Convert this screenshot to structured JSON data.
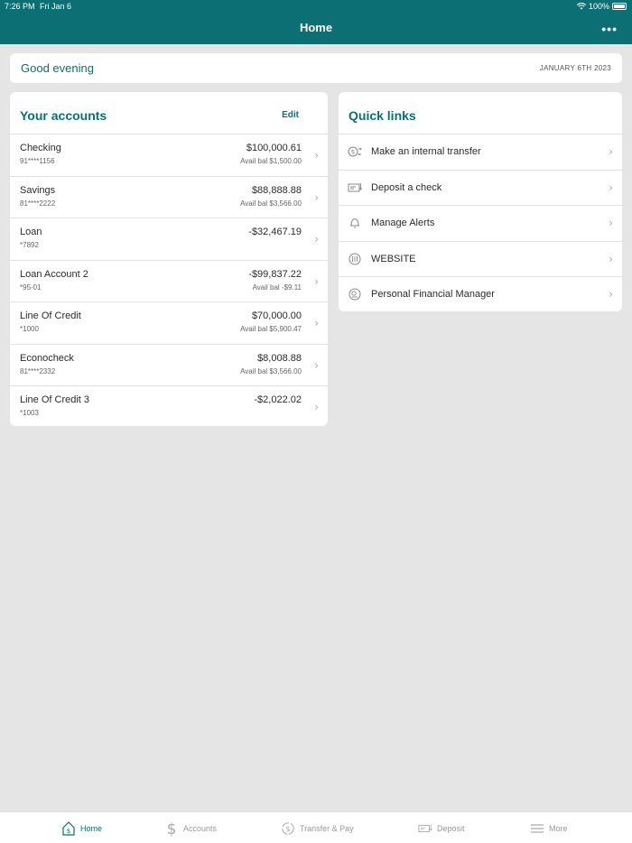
{
  "status_bar": {
    "time": "7:26 PM",
    "date": "Fri Jan 6",
    "battery": "100%"
  },
  "header": {
    "title": "Home",
    "more_label": "•••"
  },
  "greeting": {
    "text": "Good evening",
    "date": "JANUARY 6TH 2023"
  },
  "accounts": {
    "title": "Your accounts",
    "edit_label": "Edit",
    "items": [
      {
        "name": "Checking",
        "number": "91****1156",
        "balance": "$100,000.61",
        "avail": "Avail bal $1,500.00"
      },
      {
        "name": "Savings",
        "number": "81****2222",
        "balance": "$88,888.88",
        "avail": "Avail bal $3,566.00"
      },
      {
        "name": "Loan",
        "number": "*7892",
        "balance": "-$32,467.19",
        "avail": ""
      },
      {
        "name": "Loan Account 2",
        "number": "*95-01",
        "balance": "-$99,837.22",
        "avail": "Avail bal -$9.11"
      },
      {
        "name": "Line Of Credit",
        "number": "*1000",
        "balance": "$70,000.00",
        "avail": "Avail bal $5,900.47"
      },
      {
        "name": "Econocheck",
        "number": "81****2332",
        "balance": "$8,008.88",
        "avail": "Avail bal $3,566.00"
      },
      {
        "name": "Line Of Credit 3",
        "number": "*1003",
        "balance": "-$2,022.02",
        "avail": ""
      }
    ]
  },
  "quick_links": {
    "title": "Quick links",
    "items": [
      {
        "label": "Make an internal transfer",
        "icon": "transfer-icon"
      },
      {
        "label": "Deposit a check",
        "icon": "check-deposit-icon"
      },
      {
        "label": "Manage Alerts",
        "icon": "bell-icon"
      },
      {
        "label": "WEBSITE",
        "icon": "website-icon"
      },
      {
        "label": "Personal Financial Manager",
        "icon": "pfm-icon"
      }
    ]
  },
  "tabbar": {
    "items": [
      {
        "label": "Home",
        "icon": "home-icon"
      },
      {
        "label": "Accounts",
        "icon": "dollar-icon"
      },
      {
        "label": "Transfer & Pay",
        "icon": "transfer-pay-icon"
      },
      {
        "label": "Deposit",
        "icon": "deposit-icon"
      },
      {
        "label": "More",
        "icon": "menu-icon"
      }
    ]
  },
  "colors": {
    "brand": "#0b6f73",
    "background": "#e5e5e5",
    "card": "#ffffff"
  }
}
